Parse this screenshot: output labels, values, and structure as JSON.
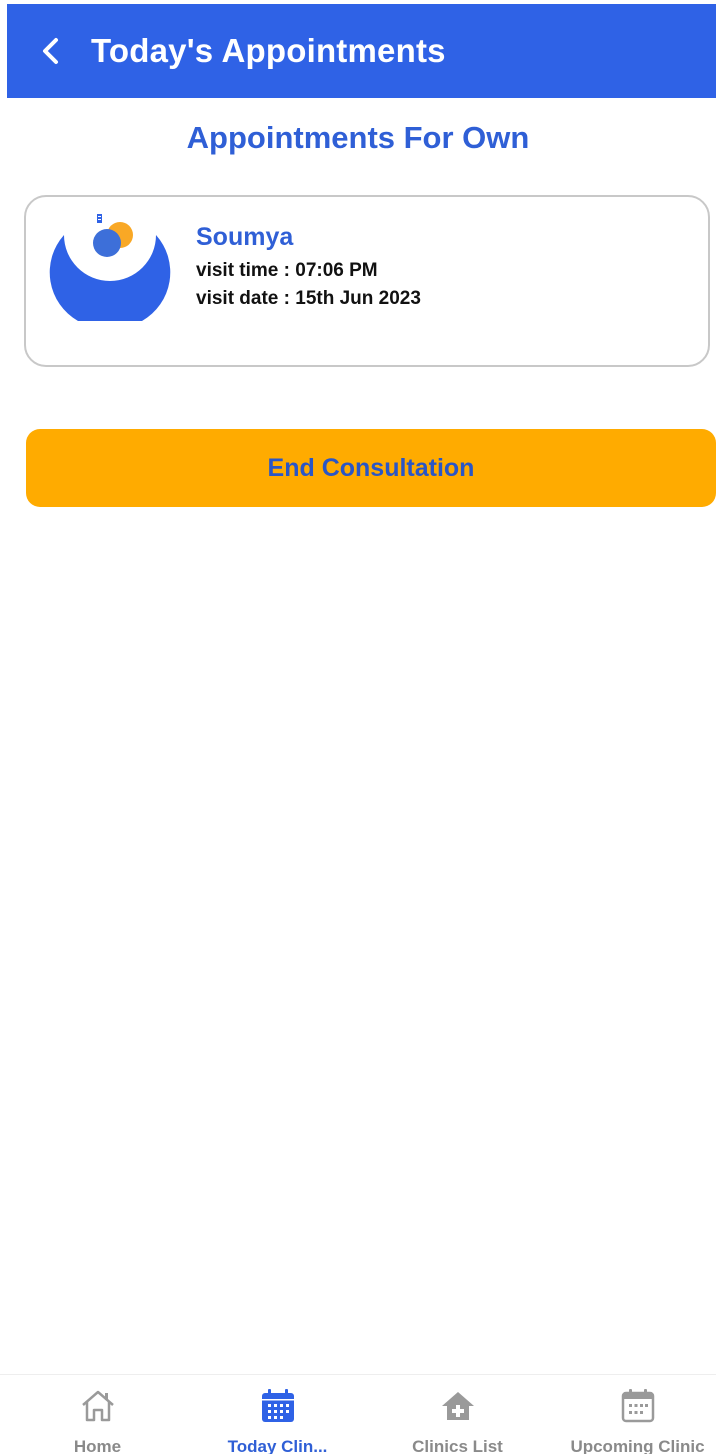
{
  "header": {
    "title": "Today's Appointments",
    "back_icon": "chevron-left-icon"
  },
  "section": {
    "title": "Appointments For Own"
  },
  "appointment": {
    "name": "Soumya",
    "visit_time": "visit time : 07:06 PM",
    "visit_date": "visit date : 15th Jun 2023",
    "avatar_icon": "clinic-logo-icon"
  },
  "actions": {
    "end_consultation": "End Consultation"
  },
  "bottom_nav": {
    "items": [
      {
        "label": "Home",
        "icon": "home-icon",
        "active": false
      },
      {
        "label": "Today Clin...",
        "icon": "calendar-icon",
        "active": true
      },
      {
        "label": "Clinics List",
        "icon": "clinic-house-icon",
        "active": false
      },
      {
        "label": "Upcoming Clinic",
        "icon": "calendar-icon",
        "active": false
      }
    ]
  },
  "colors": {
    "primary": "#2f62e6",
    "accent": "#ffab00",
    "text_blue": "#2f5fd6",
    "inactive": "#8a8a8a"
  }
}
